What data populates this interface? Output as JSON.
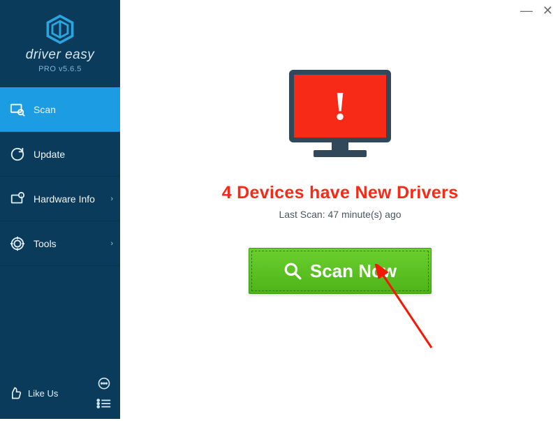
{
  "brand": {
    "name": "driver easy",
    "version": "PRO v5.6.5"
  },
  "titlebar": {
    "minimize": "—",
    "close": "✕"
  },
  "nav": {
    "scan": "Scan",
    "update": "Update",
    "hardware": "Hardware Info",
    "tools": "Tools"
  },
  "bottom": {
    "likeus": "Like Us"
  },
  "main": {
    "headline": "4 Devices have New Drivers",
    "lastscan": "Last Scan: 47 minute(s) ago",
    "scan_button": "Scan Now"
  },
  "colors": {
    "accent": "#1b9ce3",
    "sidebar": "#0b3b5b",
    "alert": "#f72a18",
    "scan": "#5bc21f"
  }
}
